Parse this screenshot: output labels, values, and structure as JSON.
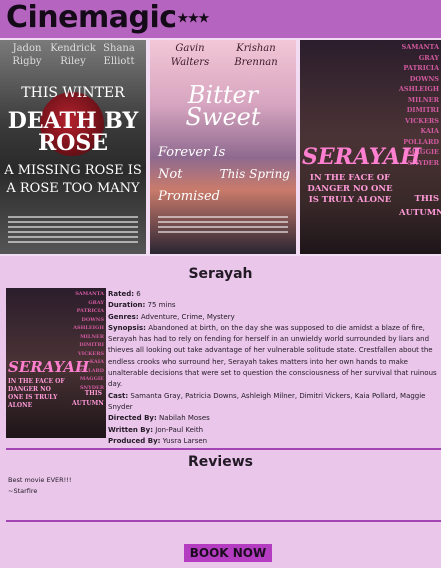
{
  "header": {
    "logo": "Cinemagic",
    "logo_stars": "★★★"
  },
  "carousel": {
    "posters": [
      {
        "cast": [
          "Jadon",
          "Kendrick",
          "Shana",
          "Rigby",
          "Riley",
          "Elliott"
        ],
        "tagline_top": "THIS WINTER",
        "title": "DEATH BY ROSE",
        "tagline_bottom": "A MISSING ROSE IS A ROSE TOO MANY"
      },
      {
        "cast": [
          "Gavin",
          "Krishan",
          "Walters",
          "Brennan"
        ],
        "title": "Bitter Sweet",
        "tagline_left": "Forever Is Not Promised",
        "tagline_right": "This Spring"
      },
      {
        "cast": [
          "SAMANTA",
          "GRAY",
          "PATRICIA",
          "DOWNS",
          "ASHLEIGH",
          "MILNER",
          "DIMITRI",
          "VICKERS",
          "KAIA",
          "POLLARD",
          "MAGGIE",
          "SNYDER"
        ],
        "title": "SERAYAH",
        "tagline": "IN THE FACE OF DANGER NO ONE IS TRULY ALONE",
        "release": "THIS AUTUMN"
      }
    ],
    "dot_count": 9,
    "active_dot": 3
  },
  "details": {
    "title": "Serayah",
    "rated_label": "Rated:",
    "rated": "6",
    "duration_label": "Duration:",
    "duration": "75 mins",
    "genres_label": "Genres:",
    "genres": "Adventure, Crime, Mystery",
    "synopsis_label": "Synopsis:",
    "synopsis": "Abandoned at birth, on the day she was supposed to die amidst a blaze of fire, Serayah has had to rely on fending for herself in an unwieldy world surrounded by liars and thieves all looking out take advantage of her vulnerable solitude state. Crestfallen about the endless crooks who surround her, Serayah takes matters into her own hands to make unalterable decisions that were set to question the consciousness of her survival that ruinous day.",
    "cast_label": "Cast:",
    "cast": "Samanta Gray, Patricia Downs, Ashleigh Milner, Dimitri Vickers, Kaia Pollard, Maggie Snyder",
    "directed_label": "Directed By:",
    "directed": "Nabilah Moses",
    "written_label": "Written By:",
    "written": "Jon-Paul Keith",
    "produced_label": "Produced By:",
    "produced": "Yusra Larsen"
  },
  "reviews": {
    "title": "Reviews",
    "items": [
      {
        "text": "Best movie EVER!!!",
        "author": "~Starfire"
      }
    ]
  },
  "booking": {
    "button_label": "BOOK NOW"
  },
  "colors": {
    "header_bg": "#b564c0",
    "page_bg": "#e9c6ea",
    "accent": "#a345b5",
    "button_bg": "#b33cc0"
  }
}
